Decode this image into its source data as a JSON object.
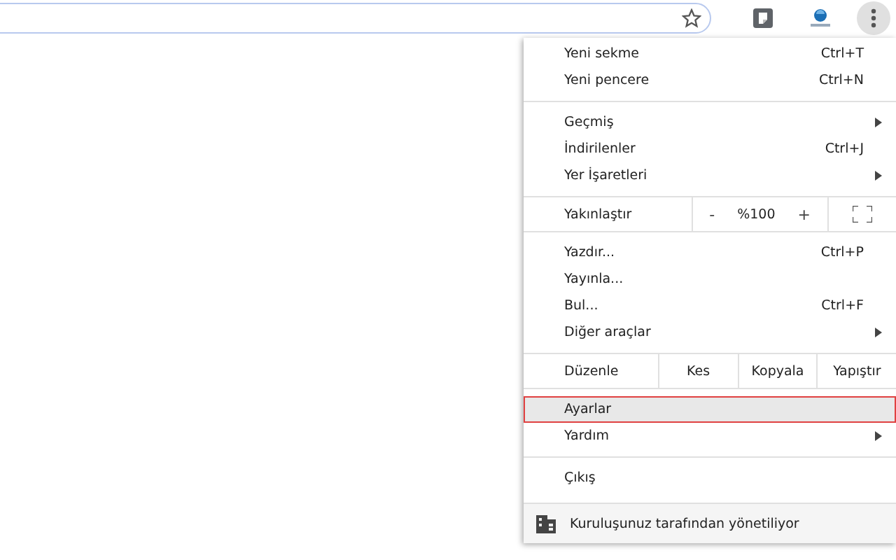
{
  "menu": [
    {
      "kind": "item",
      "label": "Yeni sekme",
      "shortcut": "Ctrl+T",
      "submenu": false,
      "selected": false
    },
    {
      "kind": "item",
      "label": "Yeni pencere",
      "shortcut": "Ctrl+N",
      "submenu": false,
      "selected": false
    },
    {
      "kind": "separator"
    },
    {
      "kind": "item",
      "label": "Geçmiş",
      "submenu": true,
      "selected": false
    },
    {
      "kind": "item",
      "label": "İndirilenler",
      "shortcut": "Ctrl+J",
      "submenu": false,
      "selected": false
    },
    {
      "kind": "item",
      "label": "Yer İşaretleri",
      "submenu": true,
      "selected": false
    },
    {
      "kind": "separator"
    },
    {
      "kind": "zoom",
      "label": "Yakınlaştır",
      "minus": "-",
      "value": "%100",
      "plus": "+"
    },
    {
      "kind": "separator"
    },
    {
      "kind": "item",
      "label": "Yazdır...",
      "shortcut": "Ctrl+P",
      "submenu": false,
      "selected": false
    },
    {
      "kind": "item",
      "label": "Yayınla...",
      "submenu": false,
      "selected": false
    },
    {
      "kind": "item",
      "label": "Bul...",
      "shortcut": "Ctrl+F",
      "submenu": false,
      "selected": false
    },
    {
      "kind": "item",
      "label": "Diğer araçlar",
      "submenu": true,
      "selected": false
    },
    {
      "kind": "separator"
    },
    {
      "kind": "edit",
      "label": "Düzenle",
      "actions": [
        "Kes",
        "Kopyala",
        "Yapıştır"
      ]
    },
    {
      "kind": "separator"
    },
    {
      "kind": "item",
      "label": "Ayarlar",
      "submenu": false,
      "selected": true
    },
    {
      "kind": "item",
      "label": "Yardım",
      "submenu": true,
      "selected": false
    },
    {
      "kind": "separator"
    },
    {
      "kind": "item",
      "label": "Çıkış",
      "submenu": false,
      "selected": false
    },
    {
      "kind": "footer",
      "label": "Kuruluşunuz tarafından yönetiliyor"
    }
  ]
}
